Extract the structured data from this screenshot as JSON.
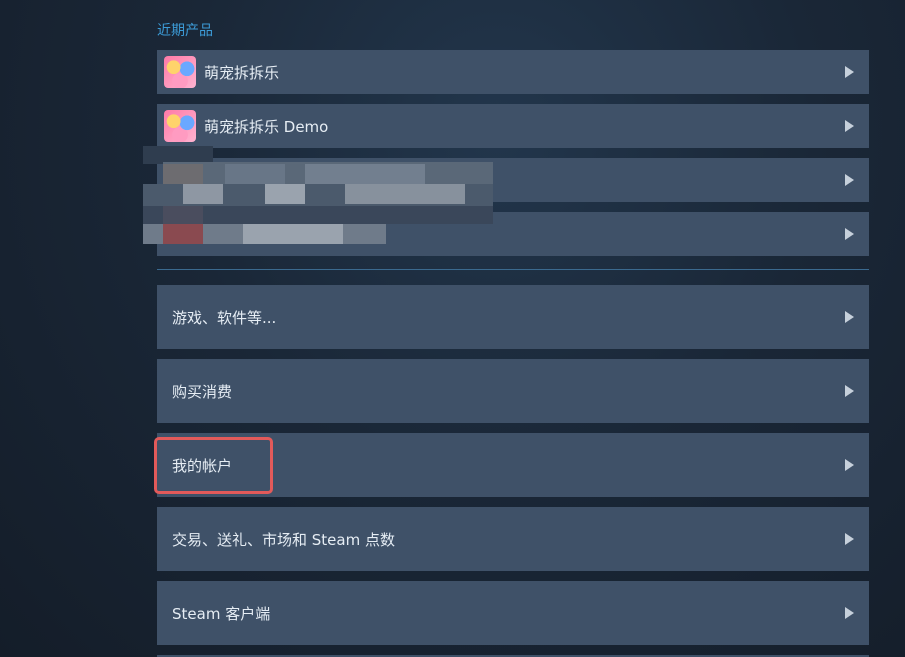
{
  "recent": {
    "title": "近期产品",
    "items": [
      {
        "label": "萌宠拆拆乐"
      },
      {
        "label": "萌宠拆拆乐 Demo"
      }
    ]
  },
  "menu": {
    "items": [
      {
        "label": "游戏、软件等..."
      },
      {
        "label": "购买消费"
      },
      {
        "label": "我的帐户"
      },
      {
        "label": "交易、送礼、市场和 Steam 点数"
      },
      {
        "label": "Steam 客户端"
      }
    ]
  },
  "colors": {
    "row_bg": "#3f5168",
    "accent_title": "#3c9bd7",
    "highlight_border": "#e25a5a"
  }
}
